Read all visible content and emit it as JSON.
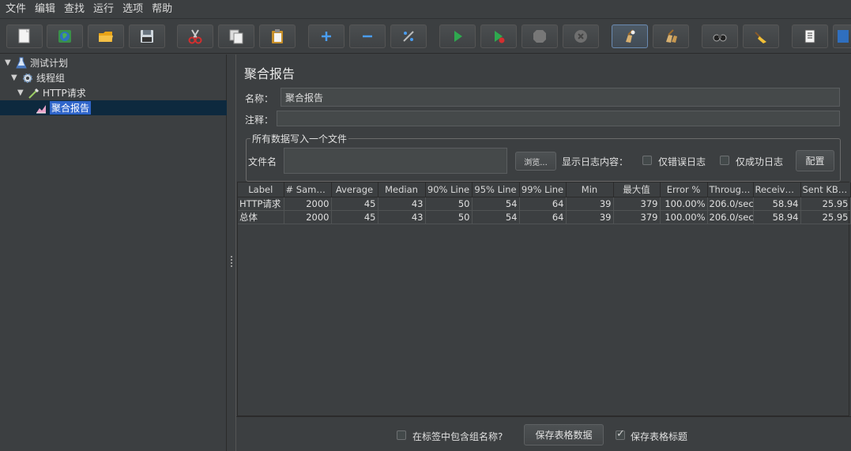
{
  "menu": [
    "文件",
    "编辑",
    "查找",
    "运行",
    "选项",
    "帮助"
  ],
  "toolbar": [
    {
      "name": "new-icon"
    },
    {
      "name": "templates-icon"
    },
    {
      "name": "open-icon"
    },
    {
      "name": "save-icon"
    },
    {
      "name": "cut-icon"
    },
    {
      "name": "copy-icon"
    },
    {
      "name": "paste-icon"
    },
    {
      "name": "expand-icon"
    },
    {
      "name": "collapse-icon"
    },
    {
      "name": "toggle-icon"
    },
    {
      "name": "start-icon"
    },
    {
      "name": "start-no-pauses-icon"
    },
    {
      "name": "stop-icon"
    },
    {
      "name": "shutdown-icon"
    },
    {
      "name": "clear-icon"
    },
    {
      "name": "clear-all-icon"
    },
    {
      "name": "search-icon"
    },
    {
      "name": "reset-search-icon"
    },
    {
      "name": "function-helper-icon"
    },
    {
      "name": "help-icon"
    }
  ],
  "tree": {
    "test_plan": "测试计划",
    "thread_group": "线程组",
    "http_request": "HTTP请求",
    "aggregate_report": "聚合报告"
  },
  "panel": {
    "title": "聚合报告",
    "name_label": "名称：",
    "name_value": "聚合报告",
    "comment_label": "注释：",
    "comment_value": "",
    "file_group_title": "所有数据写入一个文件",
    "filename_label": "文件名",
    "filename_value": "",
    "browse_label": "浏览...",
    "log_label": "显示日志内容：",
    "errors_only_label": "仅错误日志",
    "success_only_label": "仅成功日志",
    "configure_label": "配置"
  },
  "table": {
    "headers": [
      "Label",
      "# Sampl...",
      "Average",
      "Median",
      "90% Line",
      "95% Line",
      "99% Line",
      "Min",
      "最大值",
      "Error %",
      "Through...",
      "Received...",
      "Sent KB/..."
    ],
    "rows": [
      [
        "HTTP请求",
        "2000",
        "45",
        "43",
        "50",
        "54",
        "64",
        "39",
        "379",
        "100.00%",
        "206.0/sec",
        "58.94",
        "25.95"
      ],
      [
        "总体",
        "2000",
        "45",
        "43",
        "50",
        "54",
        "64",
        "39",
        "379",
        "100.00%",
        "206.0/sec",
        "58.94",
        "25.95"
      ]
    ]
  },
  "bottom": {
    "include_group_label": "在标签中包含组名称?",
    "include_group_checked": false,
    "save_table_label": "保存表格数据",
    "save_header_label": "保存表格标题",
    "save_header_checked": true
  }
}
